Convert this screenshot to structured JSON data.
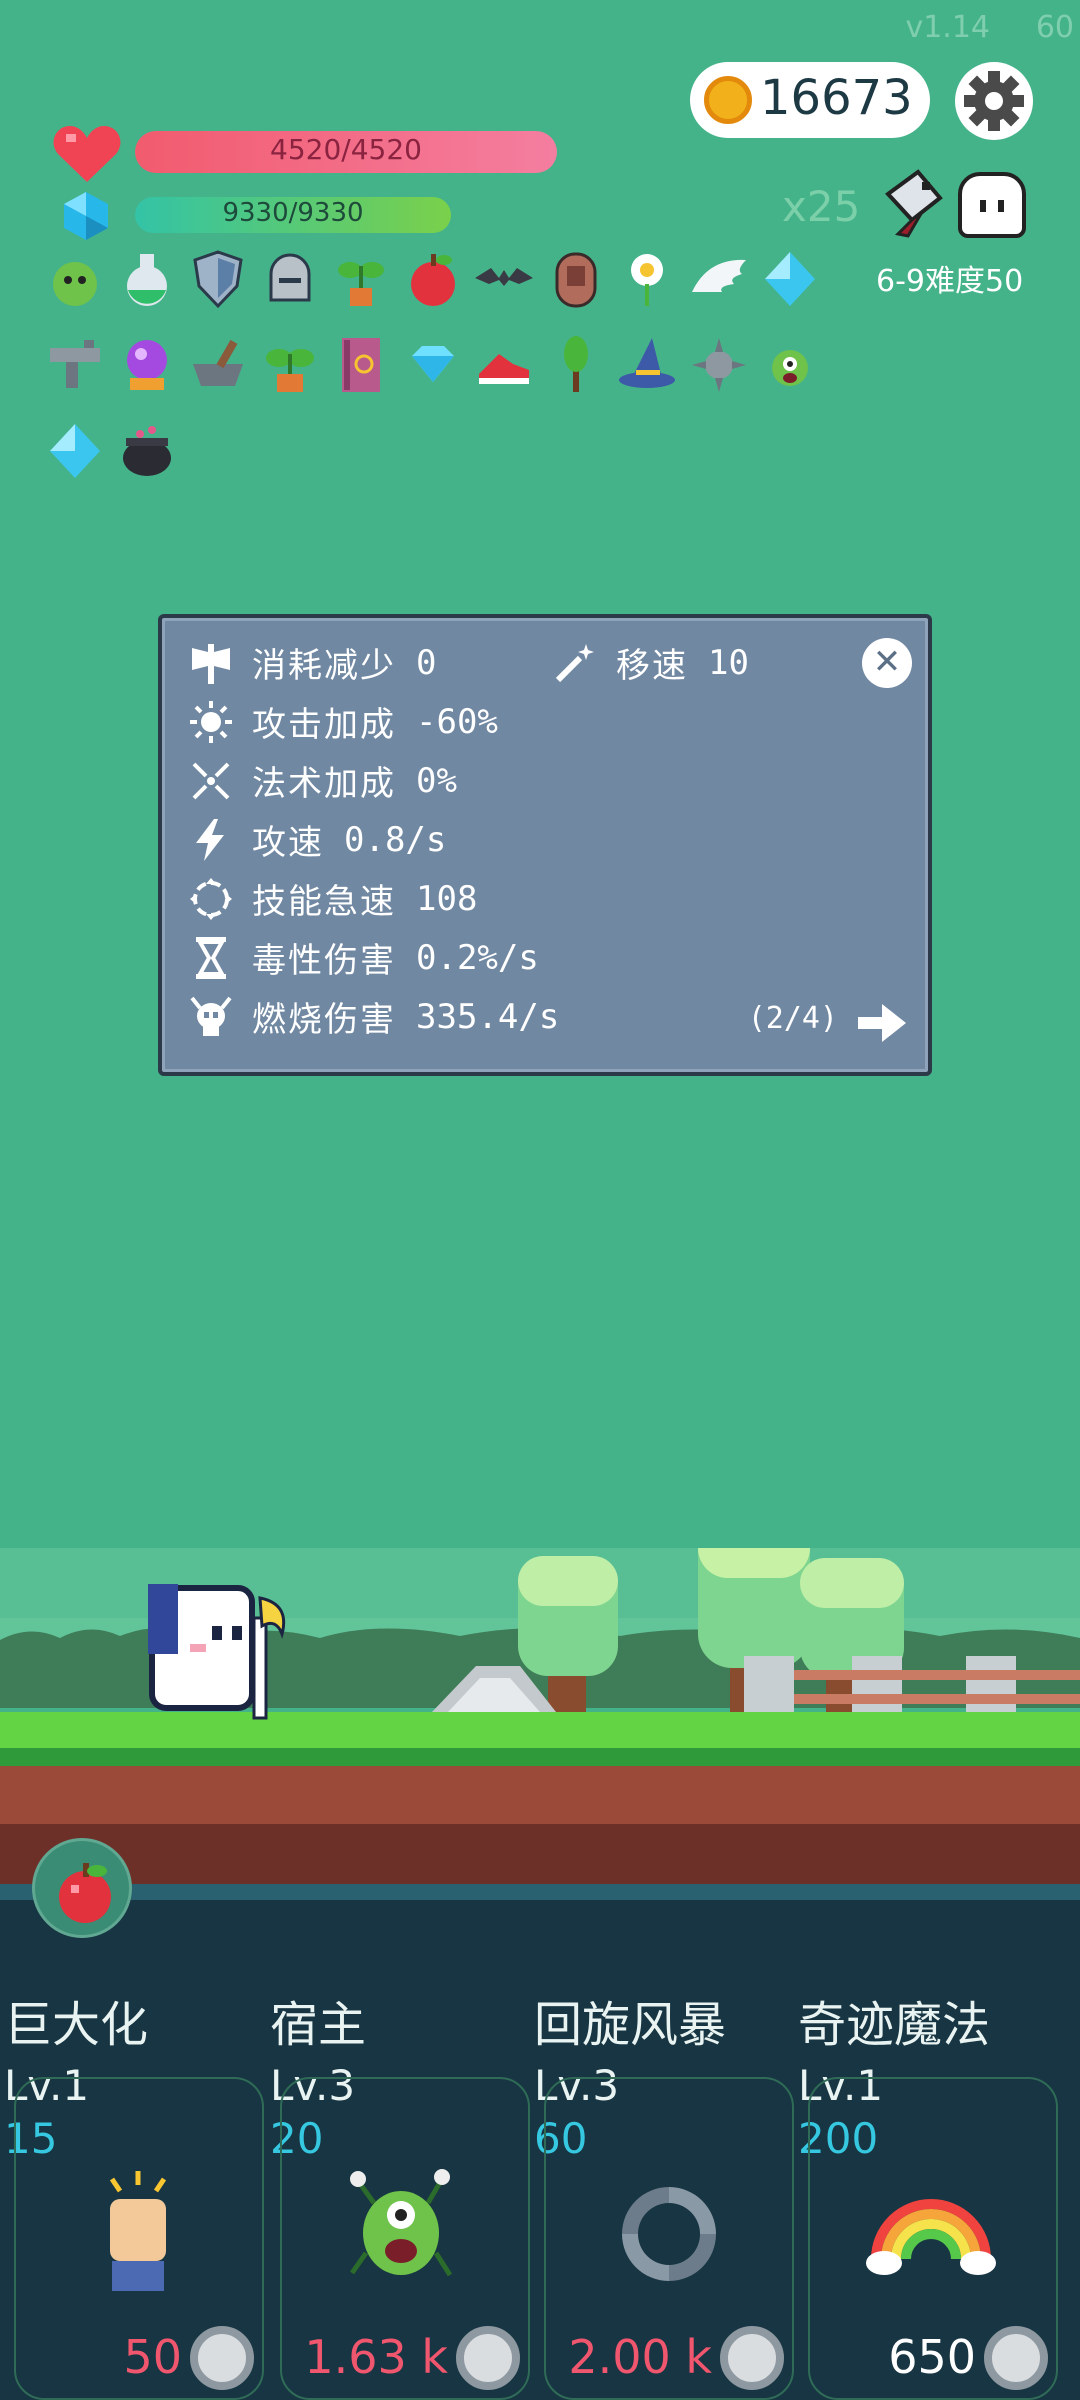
{
  "version": "v1.14",
  "fps": "60",
  "coins": "16673",
  "hp": "4520/4520",
  "mp": "9330/9330",
  "multiplier": "x25",
  "difficulty": "6-9难度50",
  "items": [
    "slime",
    "potion",
    "shield",
    "helmet",
    "plant",
    "apple",
    "bat",
    "door",
    "flower",
    "wing",
    "diamond",
    "gun",
    "crystal-ball",
    "mortar",
    "sprout",
    "book",
    "gem",
    "shoe",
    "tree",
    "witch-hat",
    "spike-ball",
    "virus",
    "diamond",
    "cauldron"
  ],
  "stats": [
    {
      "icon": "axe-icon",
      "label": "消耗减少",
      "value": "0"
    },
    {
      "icon": "sun-icon",
      "label": "攻击加成",
      "value": "-60%"
    },
    {
      "icon": "cross-icon",
      "label": "法术加成",
      "value": "0%"
    },
    {
      "icon": "bolt-icon",
      "label": "攻速",
      "value": "0.8/s"
    },
    {
      "icon": "ring-icon",
      "label": "技能急速",
      "value": "108"
    },
    {
      "icon": "hourglass-icon",
      "label": "毒性伤害",
      "value": "0.2%/s"
    },
    {
      "icon": "skull-icon",
      "label": "燃烧伤害",
      "value": "335.4/s"
    }
  ],
  "stat_right": {
    "label": "移速",
    "value": "10"
  },
  "pager": "(2/4)",
  "skills": [
    {
      "name": "巨大化",
      "level": "Lv.1",
      "cost": "15",
      "price": "50",
      "price_color": "#f0566e"
    },
    {
      "name": "宿主",
      "level": "Lv.3",
      "cost": "20",
      "price": "1.63 k",
      "price_color": "#f0566e"
    },
    {
      "name": "回旋风暴",
      "level": "Lv.3",
      "cost": "60",
      "price": "2.00 k",
      "price_color": "#f0566e"
    },
    {
      "name": "奇迹魔法",
      "level": "Lv.1",
      "cost": "200",
      "price": "650",
      "price_color": "#ffffff"
    }
  ]
}
